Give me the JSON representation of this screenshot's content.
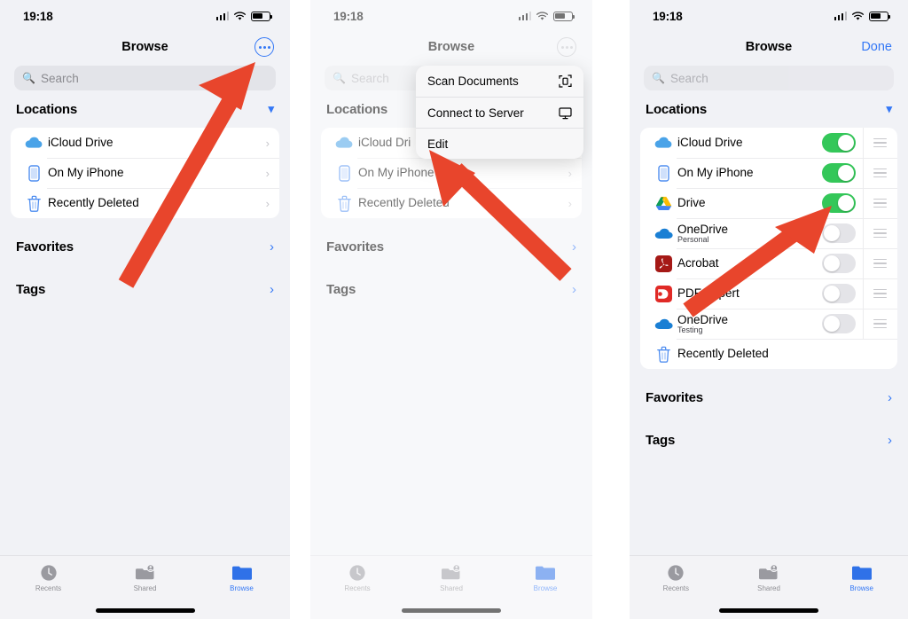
{
  "meta": {
    "accent_blue": "#3478f6",
    "toggle_green": "#34c759",
    "arrow_red": "#e8452c",
    "panel_bg": "#f1f2f6"
  },
  "status": {
    "time": "19:18"
  },
  "panel1": {
    "nav": {
      "title": "Browse",
      "menu_button": "more-options"
    },
    "search": {
      "placeholder": "Search",
      "value": ""
    },
    "sections": [
      {
        "title": "Locations",
        "chevron": "down"
      }
    ],
    "locations": [
      {
        "label": "iCloud Drive",
        "icon": "icloud-icon",
        "tail": "chevron-right"
      },
      {
        "label": "On My iPhone",
        "icon": "iphone-icon",
        "tail": "chevron-right"
      },
      {
        "label": "Recently Deleted",
        "icon": "trash-icon",
        "tail": "chevron-right"
      }
    ],
    "favorites": {
      "title": "Favorites",
      "chevron": "right"
    },
    "tags": {
      "title": "Tags",
      "chevron": "right"
    }
  },
  "panel2": {
    "nav": {
      "title": "Browse",
      "menu_button": "more-options"
    },
    "search": {
      "placeholder": "Search",
      "value": ""
    },
    "sections": [
      {
        "title": "Locations",
        "chevron": "down"
      }
    ],
    "menu": [
      {
        "label": "Scan Documents",
        "icon": "scan-document-icon"
      },
      {
        "label": "Connect to Server",
        "icon": "monitor-icon"
      },
      {
        "label": "Edit",
        "icon": ""
      }
    ],
    "locations": [
      {
        "label": "iCloud Dri",
        "icon": "icloud-icon",
        "tail": "chevron-right"
      },
      {
        "label": "On My iPhone",
        "icon": "iphone-icon",
        "tail": "chevron-right"
      },
      {
        "label": "Recently Deleted",
        "icon": "trash-icon",
        "tail": "chevron-right"
      }
    ],
    "favorites": {
      "title": "Favorites",
      "chevron": "right"
    },
    "tags": {
      "title": "Tags",
      "chevron": "right"
    }
  },
  "panel3": {
    "nav": {
      "title": "Browse",
      "done_label": "Done"
    },
    "search": {
      "placeholder": "Search",
      "value": ""
    },
    "sections": [
      {
        "title": "Locations",
        "chevron": "down"
      }
    ],
    "locations": [
      {
        "label": "iCloud Drive",
        "sublabel": "",
        "icon": "icloud-icon",
        "toggle": "on",
        "handle": true
      },
      {
        "label": "On My iPhone",
        "sublabel": "",
        "icon": "iphone-icon",
        "toggle": "on",
        "handle": true
      },
      {
        "label": "Drive",
        "sublabel": "",
        "icon": "google-drive-icon",
        "toggle": "on",
        "handle": true
      },
      {
        "label": "OneDrive",
        "sublabel": "Personal",
        "icon": "onedrive-icon",
        "toggle": "off",
        "handle": true
      },
      {
        "label": "Acrobat",
        "sublabel": "",
        "icon": "acrobat-icon",
        "toggle": "off",
        "handle": true
      },
      {
        "label": "PDF Expert",
        "sublabel": "",
        "icon": "pdf-expert-icon",
        "toggle": "off",
        "handle": true
      },
      {
        "label": "OneDrive",
        "sublabel": "Testing",
        "icon": "onedrive-icon",
        "toggle": "off",
        "handle": true
      },
      {
        "label": "Recently Deleted",
        "sublabel": "",
        "icon": "trash-icon",
        "toggle": "none",
        "handle": false
      }
    ],
    "favorites": {
      "title": "Favorites",
      "chevron": "right"
    },
    "tags": {
      "title": "Tags",
      "chevron": "right"
    }
  },
  "tabbar": {
    "tabs": [
      {
        "label": "Recents",
        "icon": "clock-icon",
        "active": false
      },
      {
        "label": "Shared",
        "icon": "shared-folder-icon",
        "active": false
      },
      {
        "label": "Browse",
        "icon": "folder-icon",
        "active": true
      }
    ]
  },
  "annotations": [
    {
      "name": "arrow-to-more-options",
      "panel": 1,
      "points_to": "more-options-button"
    },
    {
      "name": "arrow-to-edit",
      "panel": 2,
      "points_to": "menu-item-edit"
    },
    {
      "name": "arrow-to-drive-toggle",
      "panel": 3,
      "points_to": "toggle-drive"
    }
  ]
}
